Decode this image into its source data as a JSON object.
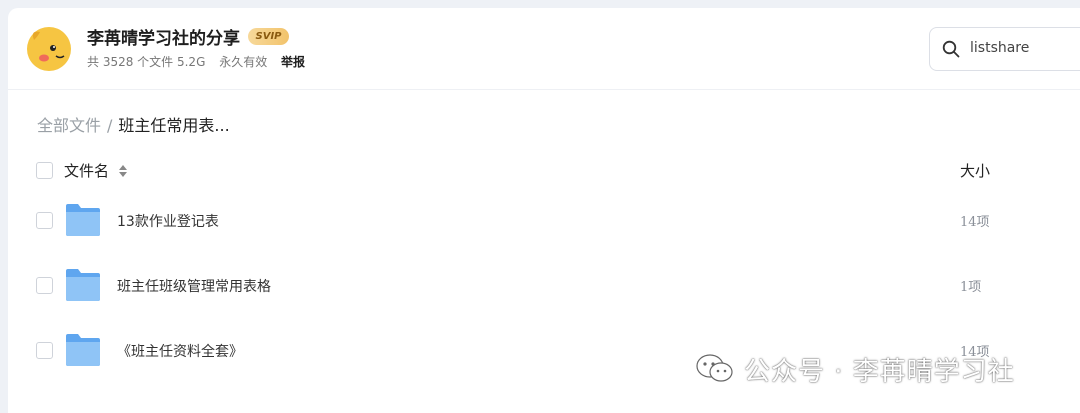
{
  "header": {
    "title": "李苒晴学习社的分享",
    "badge": "SVIP",
    "meta": {
      "file_count": "共 3528 个文件 5.2G",
      "validity": "永久有效",
      "report": "举报"
    }
  },
  "search": {
    "value": "listshare"
  },
  "breadcrumb": {
    "root": "全部文件",
    "separator": "/",
    "current": "班主任常用表..."
  },
  "table": {
    "columns": {
      "name": "文件名",
      "size": "大小"
    },
    "rows": [
      {
        "name": "13款作业登记表",
        "size": "14项",
        "icon": "folder-icon"
      },
      {
        "name": "班主任班级管理常用表格",
        "size": "1项",
        "icon": "folder-icon"
      },
      {
        "name": "《班主任资料全套》",
        "size": "14项",
        "icon": "folder-icon"
      }
    ]
  },
  "watermark": {
    "text": "公众号 · 李苒晴学习社",
    "icon": "wechat-icon"
  },
  "colors": {
    "folder": "#7fb8f2",
    "badge": "#f2c36b",
    "panel": "#ffffff",
    "background": "#eef1f6"
  }
}
